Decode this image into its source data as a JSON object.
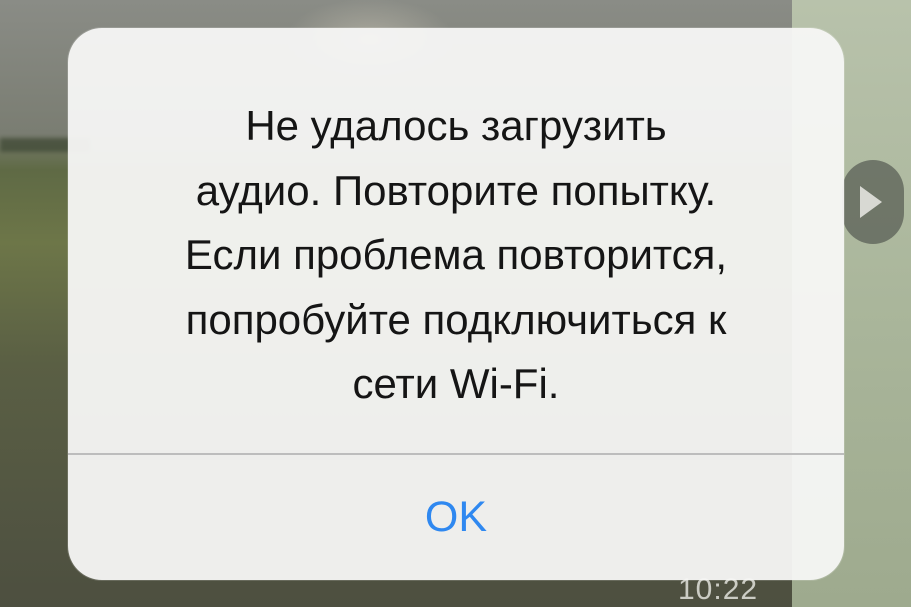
{
  "alert": {
    "message": "Не удалось загрузить\nаудио. Повторите попытку.\nЕсли проблема повторится,\nпопробуйте подключиться к\nсети Wi-Fi.",
    "ok_label": "OK"
  },
  "background": {
    "message_time": "10:22"
  },
  "colors": {
    "alert_background": "#f7f7f5",
    "message_text": "#151515",
    "button_text": "#2f88f0",
    "divider": "#bdbdbd"
  },
  "icons": {
    "forward": "forward-icon"
  }
}
